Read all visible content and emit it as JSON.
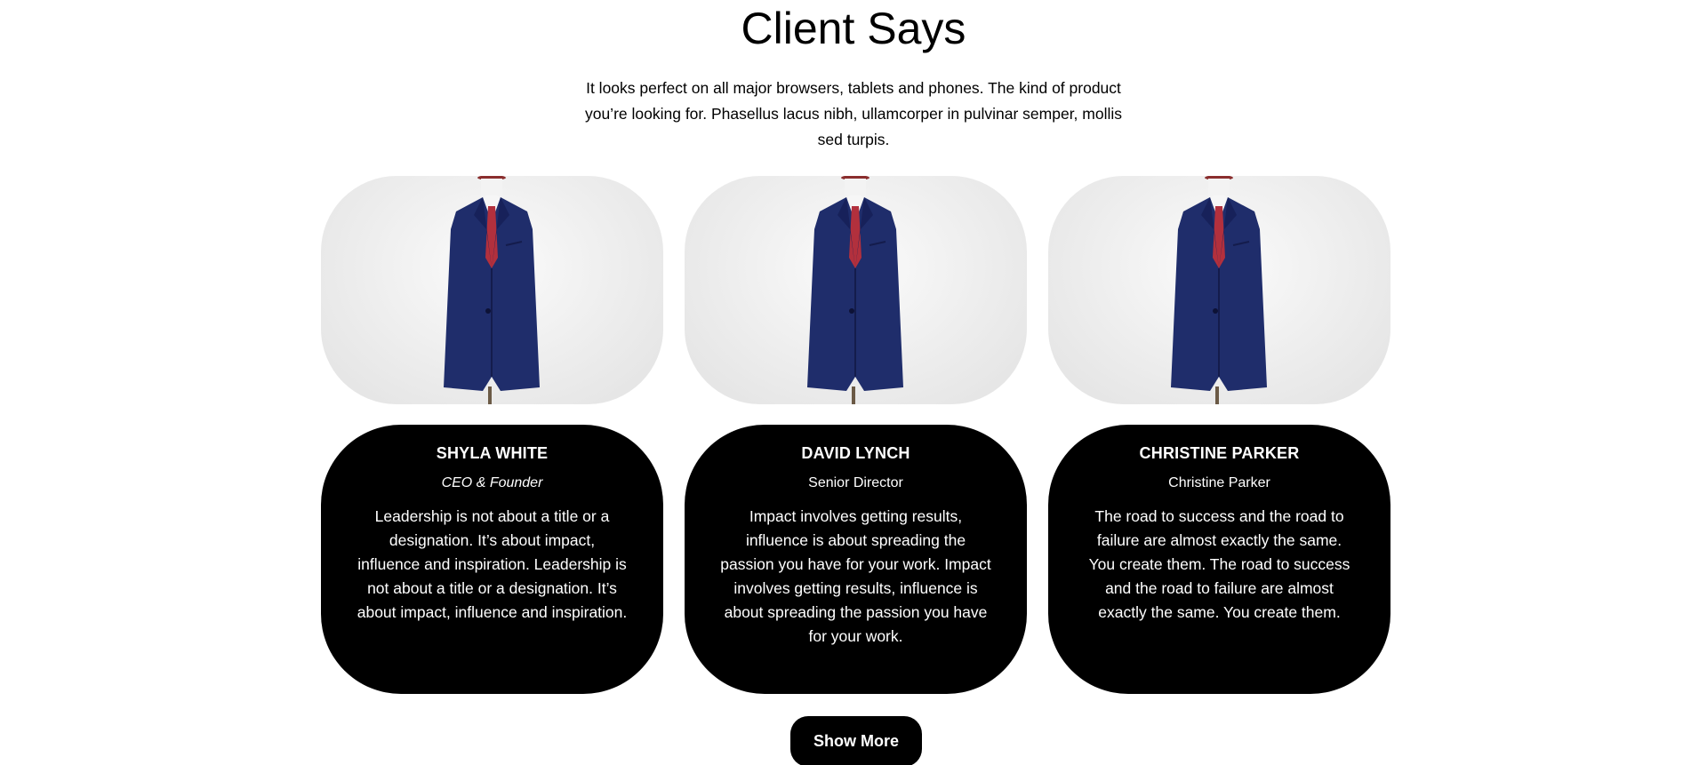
{
  "section": {
    "title": "Client Says",
    "intro": "It looks perfect on all major browsers, tablets and phones. The kind of product you’re looking for. Phasellus lacus nibh, ullamcorper in pulvinar semper, mollis sed turpis."
  },
  "testimonials": [
    {
      "name": "SHYLA WHITE",
      "role": "CEO & Founder",
      "quote": "Leadership is not about a title or a designation. It’s about impact, influence and inspiration. Leadership is not about a title or a designation. It’s about impact, influence and inspiration.",
      "photo": "navy-suit-on-mannequin"
    },
    {
      "name": "DAVID LYNCH",
      "role": "Senior Director",
      "quote": "Impact involves getting results, influence is about spreading the passion you have for your work. Impact involves getting results, influence is about spreading the passion you have for your work.",
      "photo": "navy-suit-on-mannequin"
    },
    {
      "name": "CHRISTINE PARKER",
      "role": "Christine Parker",
      "quote": "The road to success and the road to failure are almost exactly the same. You create them. The road to success and the road to failure are almost exactly the same. You create them.",
      "photo": "navy-suit-on-mannequin"
    }
  ],
  "actions": {
    "show_more_label": "Show More"
  },
  "colors": {
    "card_background": "#000000",
    "card_text": "#ffffff",
    "suit": "#1f2d6b",
    "tie": "#b2303d"
  }
}
